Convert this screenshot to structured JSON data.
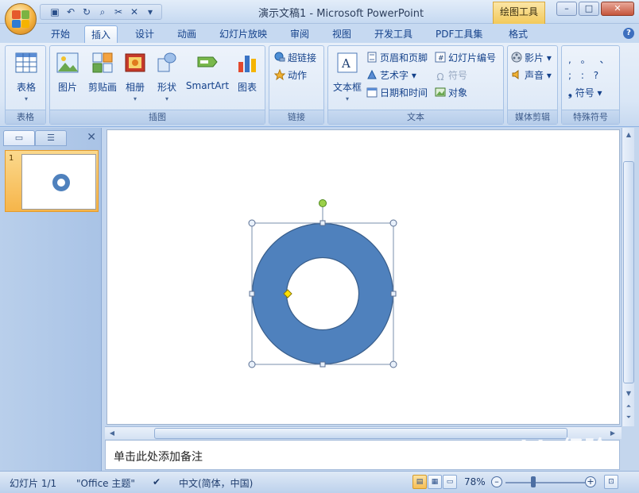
{
  "window": {
    "title": "演示文稿1 - Microsoft PowerPoint",
    "context_tab": "绘图工具",
    "controls": [
      "minimize",
      "maximize",
      "close"
    ]
  },
  "quick_access": {
    "items": [
      "save-icon",
      "undo-icon",
      "redo-icon",
      "print-preview-icon",
      "cut-icon",
      "close-doc-icon",
      "customize-icon"
    ]
  },
  "tabs": [
    {
      "label": "开始",
      "active": false
    },
    {
      "label": "插入",
      "active": true
    },
    {
      "label": "设计",
      "active": false
    },
    {
      "label": "动画",
      "active": false
    },
    {
      "label": "幻灯片放映",
      "active": false
    },
    {
      "label": "审阅",
      "active": false
    },
    {
      "label": "视图",
      "active": false
    },
    {
      "label": "开发工具",
      "active": false
    },
    {
      "label": "PDF工具集",
      "active": false
    },
    {
      "label": "格式",
      "active": false
    }
  ],
  "ribbon": {
    "groups": {
      "table": {
        "label": "表格",
        "buttons": {
          "table": "表格"
        }
      },
      "illustrations": {
        "label": "插图",
        "buttons": {
          "picture": "图片",
          "clipart": "剪贴画",
          "album": "相册",
          "shapes": "形状",
          "smartart": "SmartArt",
          "chart": "图表"
        }
      },
      "links": {
        "label": "链接",
        "buttons": {
          "hyperlink": "超链接",
          "action": "动作"
        }
      },
      "text": {
        "label": "文本",
        "buttons": {
          "textbox": "文本框",
          "header_footer": "页眉和页脚",
          "wordart": "艺术字",
          "datetime": "日期和时间",
          "slide_number": "幻灯片编号",
          "symbol": "符号",
          "object": "对象"
        }
      },
      "media": {
        "label": "媒体剪辑",
        "buttons": {
          "movie": "影片",
          "sound": "声音"
        }
      },
      "special": {
        "label": "特殊符号",
        "buttons": {
          "symbols_row1": ",  。  、",
          "symbols_row2": ";  :  ?",
          "symbol": "符号"
        }
      }
    }
  },
  "slides_pane": {
    "slide_number": "1"
  },
  "notes": {
    "placeholder": "单击此处添加备注"
  },
  "status": {
    "slide": "幻灯片 1/1",
    "theme": "\"Office 主题\"",
    "language": "中文(简体，中国)",
    "zoom": "78%",
    "zoom_level": 0.78
  },
  "watermark": {
    "brand": "Baidu经验",
    "sub": "jingyan.baidu.com"
  },
  "colors": {
    "shape_fill": "#4f81bd",
    "shape_stroke": "#385d8a",
    "rotate_handle": "#9bd04a",
    "adjust_handle": "#ffe000"
  }
}
